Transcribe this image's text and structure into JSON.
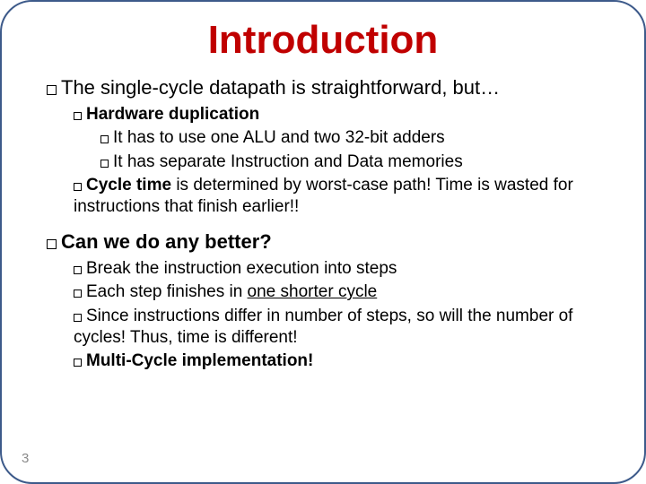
{
  "title": "Introduction",
  "page_number": "3",
  "content": {
    "p1": {
      "lead": "The single-cycle datapath is straightforward, but…",
      "hw_dup_label": "Hardware duplication",
      "hw1": "It has to use one ALU and two 32-bit adders",
      "hw2": "It has separate Instruction and Data memories",
      "cycle_bold": "Cycle time",
      "cycle_rest": " is determined by worst-case path! Time is wasted for instructions that finish earlier!!"
    },
    "p2": {
      "lead": "Can we do any better?",
      "s1": "Break the instruction execution into steps",
      "s2a": "Each step finishes in ",
      "s2u": "one shorter cycle",
      "s3": "Since instructions differ in number of steps, so will the number of cycles! Thus, time is different!",
      "s4": "Multi-Cycle implementation!"
    }
  }
}
